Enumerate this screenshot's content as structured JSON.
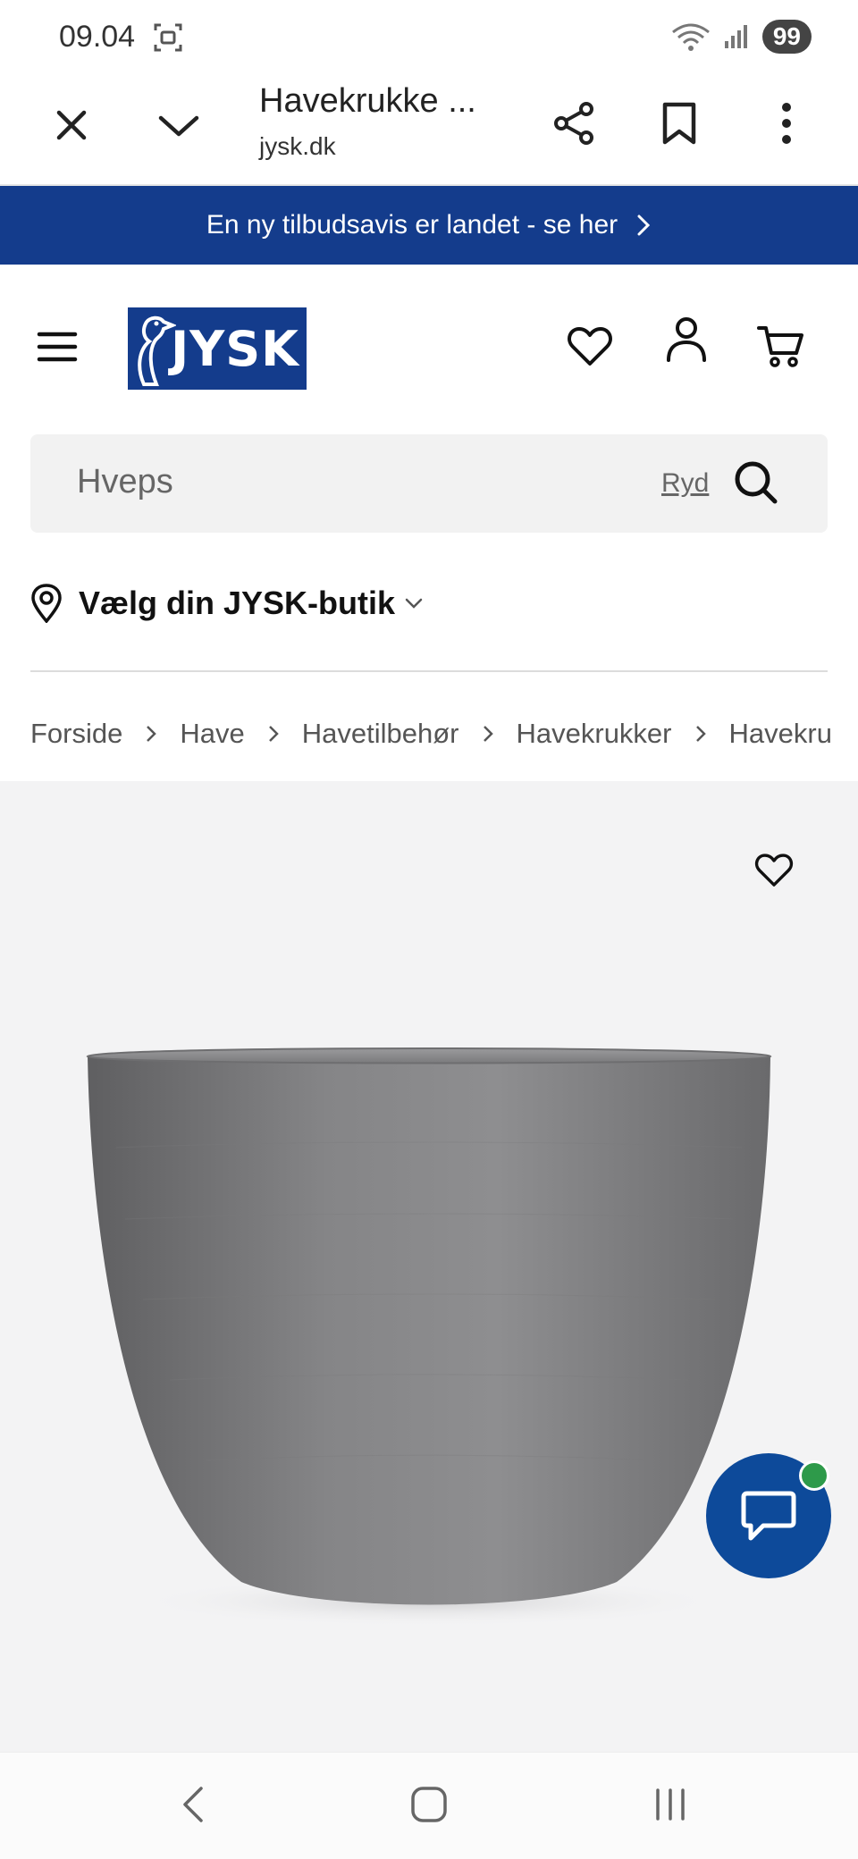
{
  "status_bar": {
    "time": "09.04",
    "battery": "99",
    "icons": [
      "screenshot-icon",
      "wifi-icon",
      "signal-icon"
    ]
  },
  "browser": {
    "title": "Havekrukke ...",
    "domain": "jysk.dk",
    "icons": [
      "close-icon",
      "chevron-down-icon",
      "share-icon",
      "bookmark-icon",
      "more-vert-icon"
    ]
  },
  "promo": {
    "text": "En ny tilbudsavis er landet - se her"
  },
  "header": {
    "logo_text": "JYSK",
    "icons": [
      "menu-icon",
      "heart-icon",
      "account-icon",
      "cart-icon"
    ]
  },
  "search": {
    "value": "Hveps",
    "clear_label": "Ryd"
  },
  "store": {
    "label": "Vælg din JYSK-butik"
  },
  "breadcrumb": {
    "items": [
      "Forside",
      "Have",
      "Havetilbehør",
      "Havekrukker",
      "Havekru"
    ]
  },
  "colors": {
    "brand_blue": "#143C8C",
    "chat_blue": "#0d4a9a",
    "online_green": "#2e9a4a",
    "image_bg": "#f3f3f4"
  }
}
